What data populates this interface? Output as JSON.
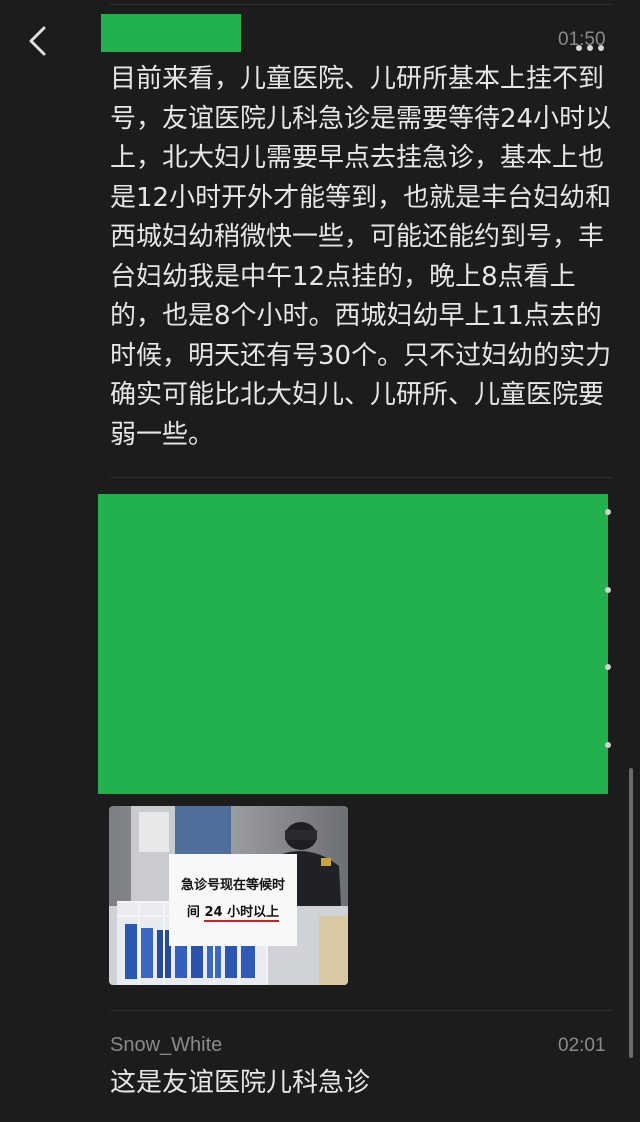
{
  "nav": {
    "back_icon": "chevron-left-icon"
  },
  "comment1": {
    "time": "01:50",
    "more_icon": "more-dots-icon",
    "text": "目前来看，儿童医院、儿研所基本上挂不到号，友谊医院儿科急诊是需要等待24小时以上，北大妇儿需要早点去挂急诊，基本上也是12小时开外才能等到，也就是丰台妇幼和西城妇幼稍微快一些，可能还能约到号，丰台妇幼我是中午12点挂的，晚上8点看上的，也是8个小时。西城妇幼早上11点去的时候，明天还有号30个。只不过妇幼的实力确实可能比北大妇儿、儿研所、儿童医院要弱一些。"
  },
  "photo": {
    "sign_line1": "急诊号现在等候时",
    "sign_line2_prefix": "间",
    "sign_line2_highlight": "24 小时以上"
  },
  "comment2": {
    "username": "Snow_White",
    "time": "02:01",
    "text": "这是友谊医院儿科急诊"
  },
  "colors": {
    "background": "#1c1c1c",
    "redaction": "#22b14c",
    "text": "#e6e6e6",
    "muted": "#8a8a8a"
  }
}
